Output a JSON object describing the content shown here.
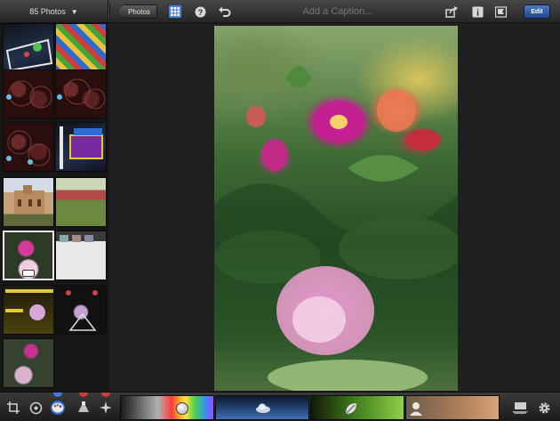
{
  "topbar": {
    "album_label": "85 Photos",
    "back_label": "Photos",
    "caption_placeholder": "Add a Caption...",
    "edit_label": "Edit"
  },
  "icons": {
    "album_caret": "▼",
    "grid": "grid-icon",
    "help": "?",
    "undo": "undo-icon",
    "share": "share-icon",
    "info": "i",
    "flag": "flag-icon"
  },
  "thumbnails": [
    {
      "id": "game1"
    },
    {
      "id": "game2"
    },
    {
      "id": "circ1"
    },
    {
      "id": "circ2"
    },
    {
      "id": "circ3"
    },
    {
      "id": "game3"
    },
    {
      "id": "castle"
    },
    {
      "id": "garden"
    },
    {
      "id": "flower",
      "selected": true
    },
    {
      "id": "screen"
    },
    {
      "id": "yellow"
    },
    {
      "id": "dark"
    },
    {
      "id": "flower2"
    }
  ],
  "bottombar": {
    "tools": [
      "crop-icon",
      "rotate-icon",
      "palette-icon",
      "brush-icon",
      "effects-icon"
    ],
    "sliders": [
      "exposure",
      "sky",
      "foliage",
      "skin"
    ],
    "accent": "#2f6cd4"
  }
}
